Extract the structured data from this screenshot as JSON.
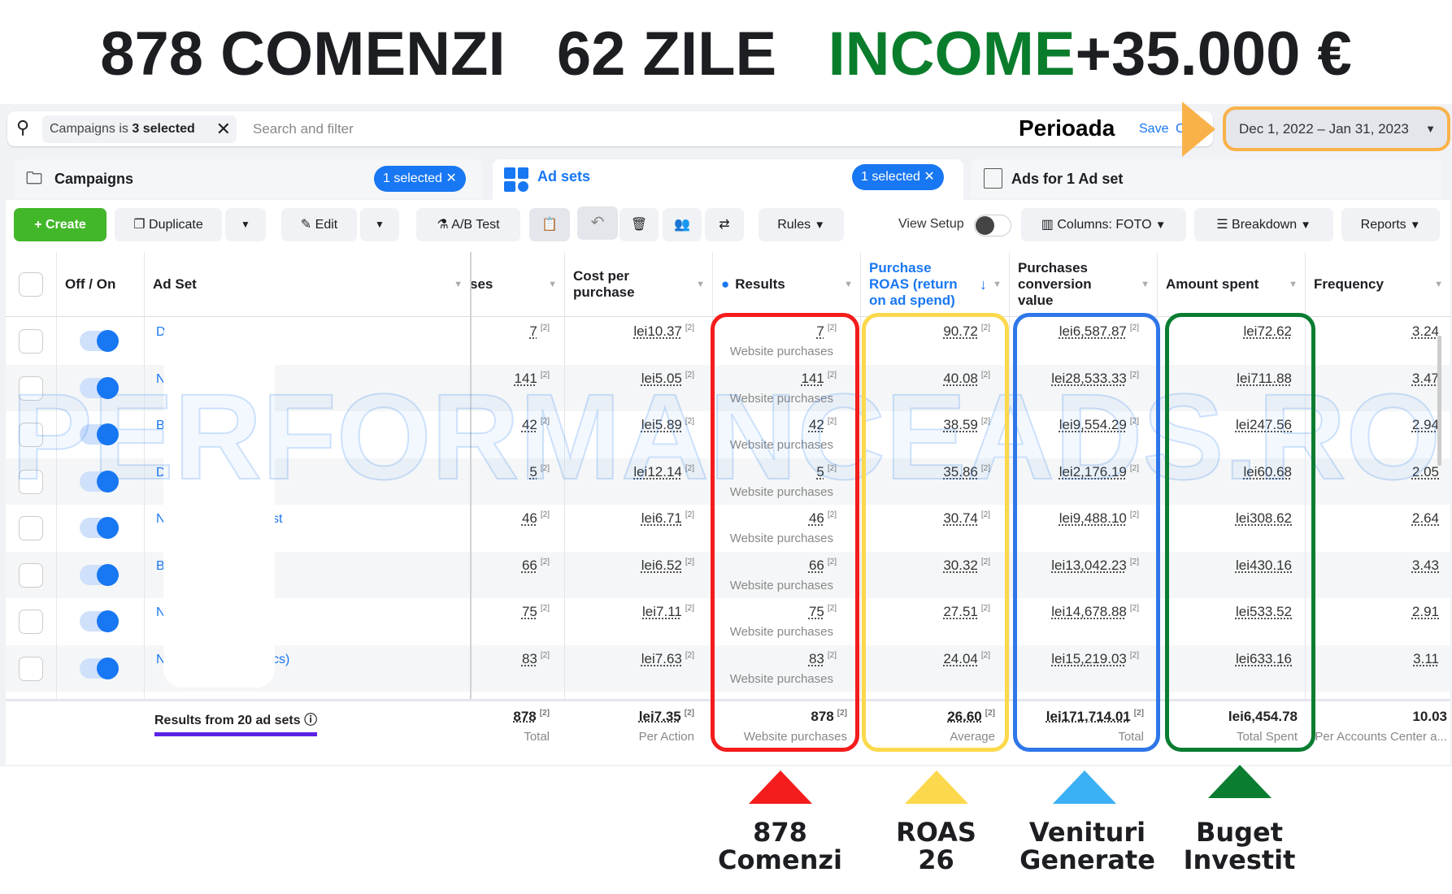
{
  "headline": {
    "part1": "878 COMENZI   62 ZILE   ",
    "part2": "INCOME",
    "part3": "+35.000 €"
  },
  "colors": {
    "green": "#0a7d2c",
    "red": "#f41c1c",
    "yellow": "#fcd94c",
    "blue": "#2f76e8",
    "lightblue": "#3bb0f5",
    "darkgreen": "#0a7d31",
    "orange": "#f9b24a",
    "primary": "#1877f2",
    "create": "#42b72a"
  },
  "search": {
    "filter_prefix": "Campaigns is ",
    "filter_value": "3 selected",
    "placeholder": "Search and filter",
    "perioada": "Perioada",
    "save": "Save",
    "clear": "C",
    "date_range": "Dec 1, 2022 – Jan 31, 2023"
  },
  "tabs": [
    {
      "label": "Campaigns",
      "badge": "1 selected"
    },
    {
      "label": "Ad sets",
      "badge": "1 selected"
    },
    {
      "label": "Ads for 1 Ad set"
    }
  ],
  "toolbar": {
    "create": "Create",
    "duplicate": "Duplicate",
    "edit": "Edit",
    "ab_test": "A/B Test",
    "rules": "Rules",
    "view_setup": "View Setup",
    "columns": "Columns: FOTO",
    "breakdown": "Breakdown",
    "reports": "Reports"
  },
  "columns": {
    "onoff": "Off / On",
    "adset": "Ad Set",
    "purchases": "ses",
    "cpp": "Cost per purchase",
    "results": "Results",
    "roas": "Purchase ROAS (return on ad spend)",
    "conv": "Purchases conversion value",
    "spent": "Amount spent",
    "freq": "Frequency"
  },
  "rows": [
    {
      "name": "D",
      "purchases": "7",
      "cpp": "lei10.37",
      "results": "7",
      "roas": "90.72",
      "conv": "lei6,587.87",
      "spent": "lei72.62",
      "freq": "3.24"
    },
    {
      "name": "N",
      "purchases": "141",
      "cpp": "lei5.05",
      "results": "141",
      "roas": "40.08",
      "conv": "lei28,533.33",
      "spent": "lei711.88",
      "freq": "3.47"
    },
    {
      "name": "B",
      "purchases": "42",
      "cpp": "lei5.89",
      "results": "42",
      "roas": "38.59",
      "conv": "lei9,554.29",
      "spent": "lei247.56",
      "freq": "2.94"
    },
    {
      "name": "D",
      "purchases": "5",
      "cpp": "lei12.14",
      "results": "5",
      "roas": "35.86",
      "conv": "lei2,176.19",
      "spent": "lei60.68",
      "freq": "2.05"
    },
    {
      "name": "N",
      "tail": "st",
      "purchases": "46",
      "cpp": "lei6.71",
      "results": "46",
      "roas": "30.74",
      "conv": "lei9,488.10",
      "spent": "lei308.62",
      "freq": "2.64"
    },
    {
      "name": "B",
      "purchases": "66",
      "cpp": "lei6.52",
      "results": "66",
      "roas": "30.32",
      "conv": "lei13,042.23",
      "spent": "lei430.16",
      "freq": "3.43"
    },
    {
      "name": "N",
      "purchases": "75",
      "cpp": "lei7.11",
      "results": "75",
      "roas": "27.51",
      "conv": "lei14,678.88",
      "spent": "lei533.52",
      "freq": "2.91"
    },
    {
      "name": "N",
      "tail": "cs)",
      "purchases": "83",
      "cpp": "lei7.63",
      "results": "83",
      "roas": "24.04",
      "conv": "lei15,219.03",
      "spent": "lei633.16",
      "freq": "3.11"
    }
  ],
  "result_sub": "Website purchases",
  "attr_mark": "[2]",
  "totals": {
    "label": "Results from 20 ad sets",
    "purchases": "878",
    "purchases_sub": "Total",
    "cpp": "lei7.35",
    "cpp_sub": "Per Action",
    "results": "878",
    "results_sub": "Website purchases",
    "roas": "26.60",
    "roas_sub": "Average",
    "conv": "lei171,714.01",
    "conv_sub": "Total",
    "spent": "lei6,454.78",
    "spent_sub": "Total Spent",
    "freq": "10.03",
    "freq_sub": "Per Accounts Center a..."
  },
  "watermark": "PERFORMANCEADS.RO",
  "annotations": [
    {
      "l1": "878",
      "l2": "Comenzi"
    },
    {
      "l1": "ROAS",
      "l2": "26"
    },
    {
      "l1": "Venituri",
      "l2": "Generate"
    },
    {
      "l1": "Buget",
      "l2": "Investit"
    }
  ]
}
